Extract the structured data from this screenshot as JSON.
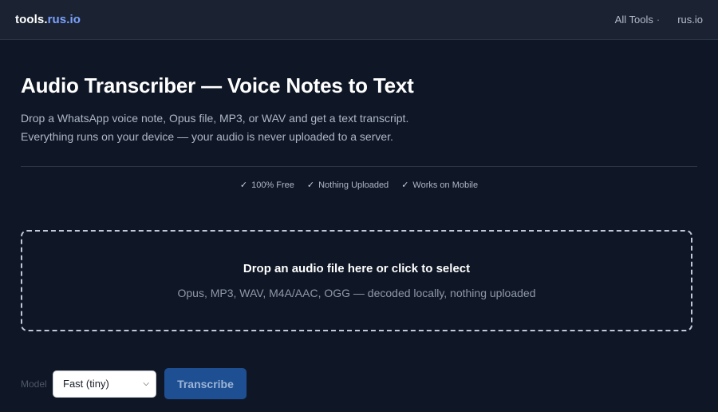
{
  "header": {
    "logo_main": "tools.",
    "logo_accent": "rus.io",
    "nav": [
      {
        "label": "All Tools",
        "sep": "·"
      },
      {
        "label": "rus.io"
      }
    ]
  },
  "main": {
    "title": "Audio Transcriber — Voice Notes to Text",
    "description_line1": "Drop a WhatsApp voice note, Opus file, MP3, or WAV and get a text transcript.",
    "description_line2": "Everything runs on your device — your audio is never uploaded to a server.",
    "badges": [
      {
        "icon": "check-icon",
        "label": "100% Free"
      },
      {
        "icon": "check-icon",
        "label": "Nothing Uploaded"
      },
      {
        "icon": "check-icon",
        "label": "Works on Mobile"
      }
    ],
    "dropzone": {
      "title": "Drop an audio file here or click to select",
      "subtitle": "Opus, MP3, WAV, M4A/AAC, OGG — decoded locally, nothing uploaded"
    },
    "controls": {
      "model_label": "Model",
      "model_selected": "Fast (tiny)",
      "transcribe_label": "Transcribe"
    }
  },
  "colors": {
    "background": "#0f1726",
    "topbar": "#1b2332",
    "accent": "#7aa2ff",
    "button": "#1d4f92"
  }
}
